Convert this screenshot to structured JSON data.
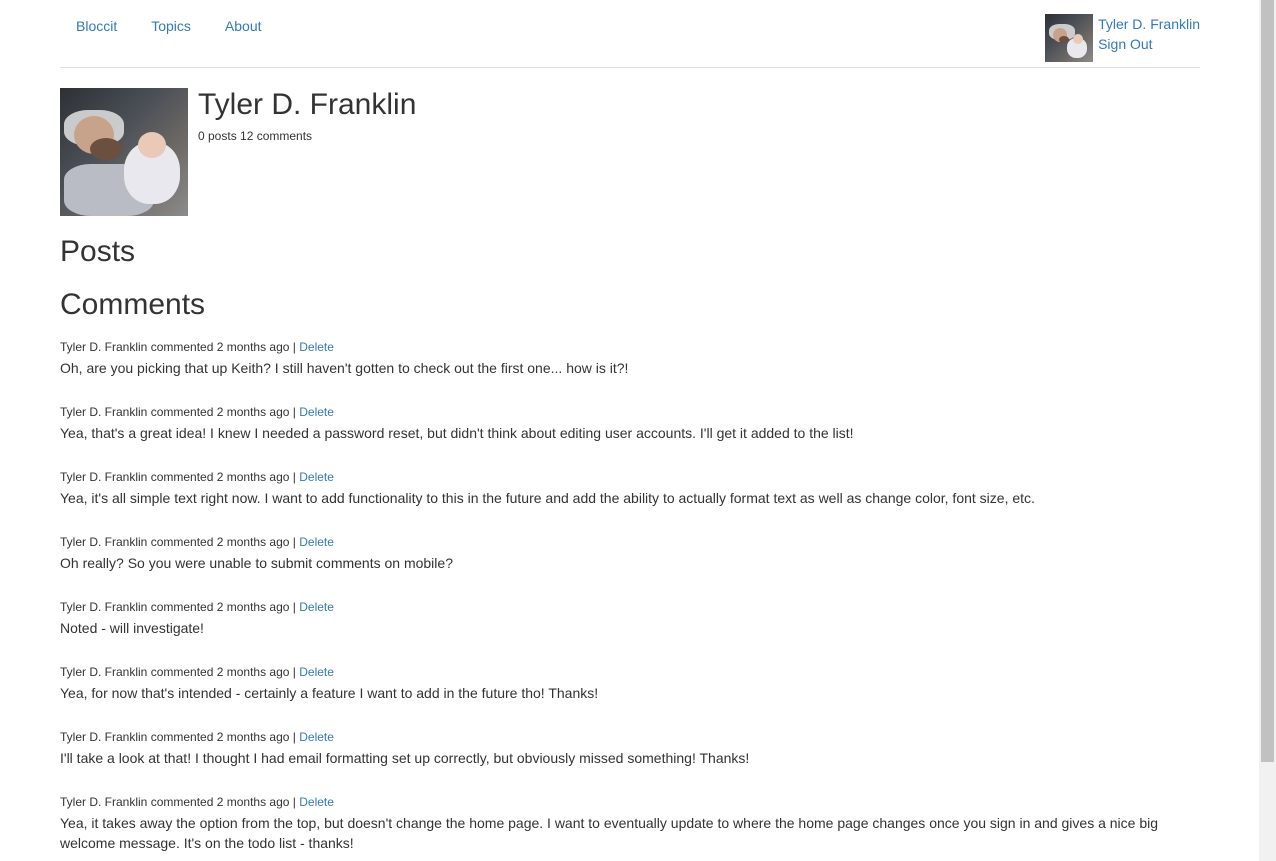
{
  "nav": {
    "links": [
      "Bloccit",
      "Topics",
      "About"
    ],
    "user_name": "Tyler D. Franklin",
    "sign_out": "Sign Out"
  },
  "profile": {
    "name": "Tyler D. Franklin",
    "stats": "0 posts 12 comments"
  },
  "sections": {
    "posts": "Posts",
    "comments": "Comments"
  },
  "comments": [
    {
      "author": "Tyler D. Franklin",
      "meta": "commented 2 months ago |",
      "action": "Delete",
      "body": "Oh, are you picking that up Keith? I still haven't gotten to check out the first one... how is it?!"
    },
    {
      "author": "Tyler D. Franklin",
      "meta": "commented 2 months ago |",
      "action": "Delete",
      "body": "Yea, that's a great idea! I knew I needed a password reset, but didn't think about editing user accounts. I'll get it added to the list!"
    },
    {
      "author": "Tyler D. Franklin",
      "meta": "commented 2 months ago |",
      "action": "Delete",
      "body": "Yea, it's all simple text right now. I want to add functionality to this in the future and add the ability to actually format text as well as change color, font size, etc."
    },
    {
      "author": "Tyler D. Franklin",
      "meta": "commented 2 months ago |",
      "action": "Delete",
      "body": "Oh really? So you were unable to submit comments on mobile?"
    },
    {
      "author": "Tyler D. Franklin",
      "meta": "commented 2 months ago |",
      "action": "Delete",
      "body": "Noted - will investigate!"
    },
    {
      "author": "Tyler D. Franklin",
      "meta": "commented 2 months ago |",
      "action": "Delete",
      "body": "Yea, for now that's intended - certainly a feature I want to add in the future tho! Thanks!"
    },
    {
      "author": "Tyler D. Franklin",
      "meta": "commented 2 months ago |",
      "action": "Delete",
      "body": "I'll take a look at that! I thought I had email formatting set up correctly, but obviously missed something! Thanks!"
    },
    {
      "author": "Tyler D. Franklin",
      "meta": "commented 2 months ago |",
      "action": "Delete",
      "body": "Yea, it takes away the option from the top, but doesn't change the home page. I want to eventually update to where the home page changes once you sign in and gives a nice big welcome message. It's on the todo list - thanks!"
    }
  ],
  "colors": {
    "link": "#337ab7",
    "text": "#333333",
    "border": "#dddddd"
  }
}
